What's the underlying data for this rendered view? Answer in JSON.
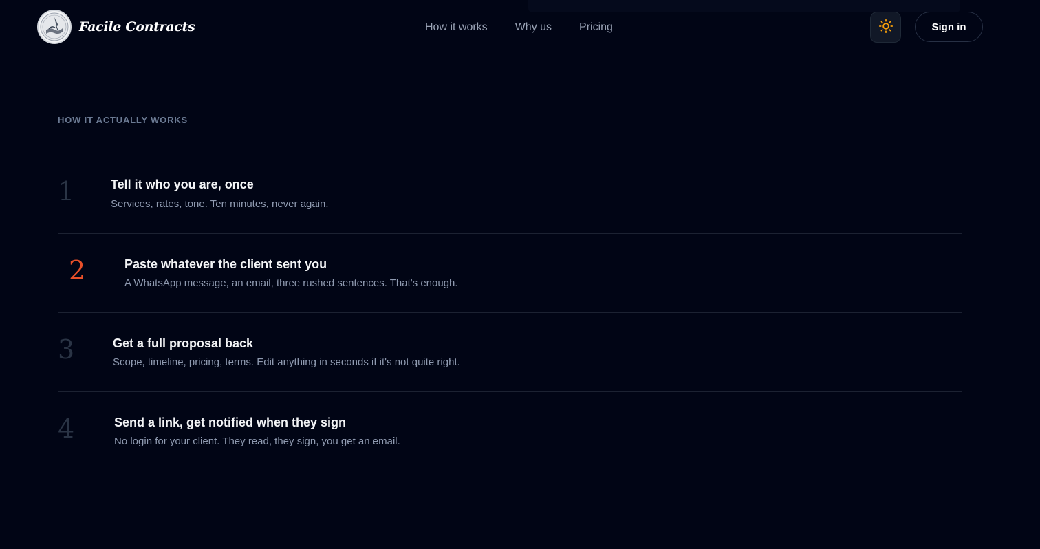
{
  "header": {
    "brand_name": "Facile Contracts",
    "logo_icon": "handshake-quill-seal-icon",
    "nav": [
      {
        "label": "How it works"
      },
      {
        "label": "Why us"
      },
      {
        "label": "Pricing"
      }
    ],
    "theme_toggle_icon": "sun-icon",
    "signin_label": "Sign in"
  },
  "section": {
    "eyebrow": "HOW IT ACTUALLY WORKS",
    "steps": [
      {
        "number": "1",
        "title": "Tell it who you are, once",
        "description": "Services, rates, tone. Ten minutes, never again."
      },
      {
        "number": "2",
        "title": "Paste whatever the client sent you",
        "description": "A WhatsApp message, an email, three rushed sentences. That's enough."
      },
      {
        "number": "3",
        "title": "Get a full proposal back",
        "description": "Scope, timeline, pricing, terms. Edit anything in seconds if it's not quite right."
      },
      {
        "number": "4",
        "title": "Send a link, get notified when they sign",
        "description": "No login for your client. They read, they sign, you get an email."
      }
    ],
    "active_step": 2
  },
  "colors": {
    "background": "#010515",
    "accent": "#e8502a",
    "sun": "#f59e0b",
    "muted_text": "#8f9ab0",
    "step_number": "#2a3445"
  }
}
